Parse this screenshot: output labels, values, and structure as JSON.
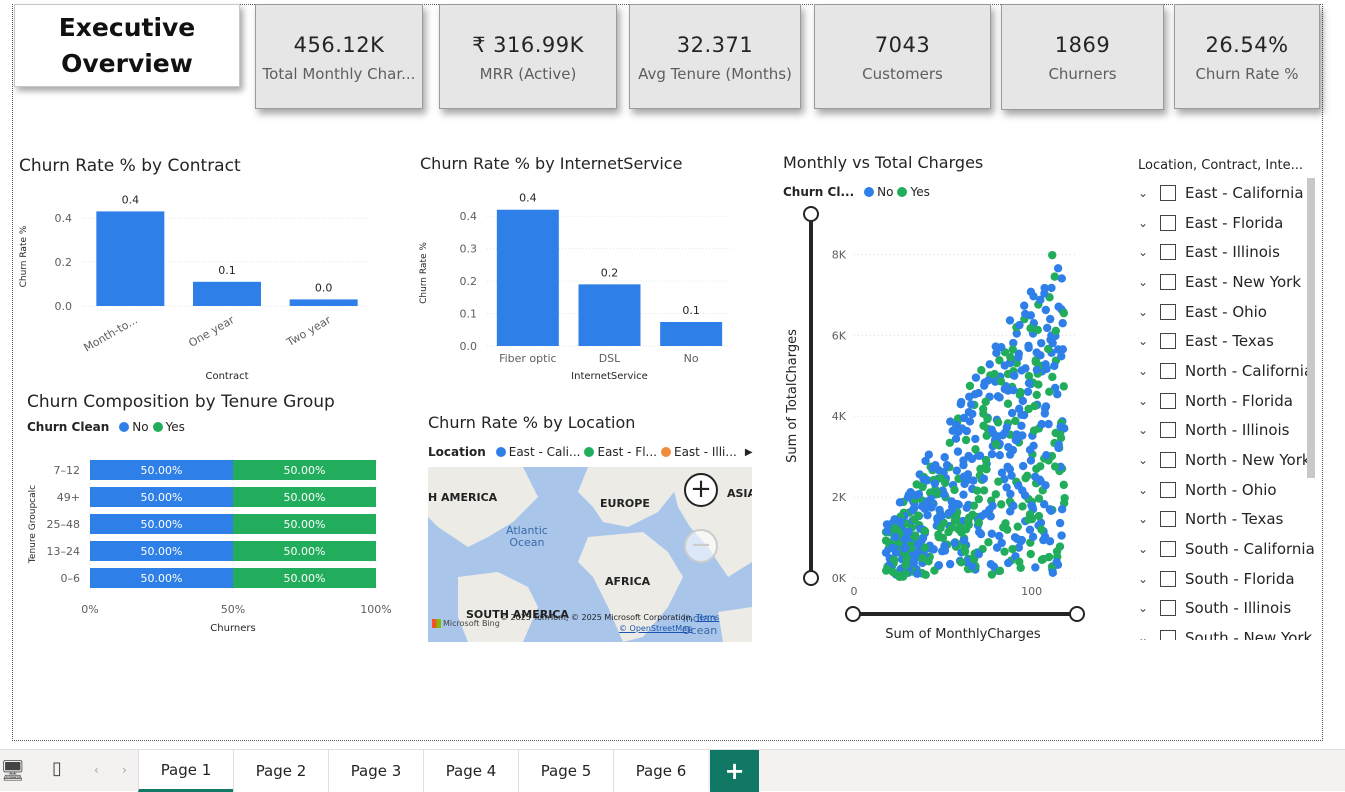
{
  "title": "Executive\nOverview",
  "kpis": [
    {
      "value": "456.12K",
      "label": "Total Monthly Char..."
    },
    {
      "value": "₹ 316.99K",
      "label": "MRR (Active)"
    },
    {
      "value": "32.371",
      "label": "Avg Tenure (Months)"
    },
    {
      "value": "7043",
      "label": "Customers"
    },
    {
      "value": "1869",
      "label": "Churners"
    },
    {
      "value": "26.54%",
      "label": "Churn Rate %"
    }
  ],
  "contract_chart": {
    "title": "Churn Rate % by Contract"
  },
  "internet_chart": {
    "title": "Churn Rate % by InternetService"
  },
  "tenure_chart": {
    "title": "Churn Composition by Tenure Group",
    "legend_title": "Churn Clean",
    "legend": [
      "No",
      "Yes"
    ]
  },
  "scatter_chart": {
    "title": "Monthly vs Total Charges",
    "legend_title": "Churn Cl...",
    "legend": [
      "No",
      "Yes"
    ]
  },
  "location_map": {
    "title": "Churn Rate % by Location",
    "legend_title": "Location",
    "legend": [
      "East - Cali...",
      "East - Fl...",
      "East - Illi..."
    ],
    "labels": [
      "H AMERICA",
      "EUROPE",
      "ASIA",
      "AFRICA",
      "SOUTH AMERICA"
    ],
    "ocean": "Atlantic\nOcean",
    "indian": "Indian\nOcean",
    "attribution": "© 2025 TomTom, © 2025 Microsoft Corporation,",
    "terms": "Terms",
    "osm": "© OpenStreetMap",
    "bing": "Microsoft Bing"
  },
  "slicer": {
    "title": "Location, Contract, Inte...",
    "items": [
      "East - California",
      "East - Florida",
      "East - Illinois",
      "East - New York",
      "East - Ohio",
      "East - Texas",
      "North - California",
      "North - Florida",
      "North - Illinois",
      "North - New York",
      "North - Ohio",
      "North - Texas",
      "South - California",
      "South - Florida",
      "South - Illinois",
      "South - New York"
    ]
  },
  "tabs": [
    "Page 1",
    "Page 2",
    "Page 3",
    "Page 4",
    "Page 5",
    "Page 6"
  ],
  "colors": {
    "no": "#2f7fe8",
    "yes": "#22ad5c",
    "third": "#f08c3c",
    "tab": "#117865"
  },
  "chart_data": [
    {
      "type": "bar",
      "title": "Churn Rate % by Contract",
      "xlabel": "Contract",
      "ylabel": "Churn Rate %",
      "categories": [
        "Month-to...",
        "One year",
        "Two year"
      ],
      "values": [
        0.43,
        0.11,
        0.03
      ],
      "data_labels": [
        "0.4",
        "0.1",
        "0.0"
      ],
      "yticks": [
        "0.0",
        "0.2",
        "0.4"
      ],
      "ylim": [
        0,
        0.45
      ]
    },
    {
      "type": "bar",
      "title": "Churn Rate % by InternetService",
      "xlabel": "InternetService",
      "ylabel": "Churn Rate %",
      "categories": [
        "Fiber optic",
        "DSL",
        "No"
      ],
      "values": [
        0.42,
        0.19,
        0.074
      ],
      "data_labels": [
        "0.4",
        "0.2",
        "0.1"
      ],
      "yticks": [
        "0.0",
        "0.1",
        "0.2",
        "0.3",
        "0.4"
      ],
      "ylim": [
        0,
        0.45
      ]
    },
    {
      "type": "bar",
      "title": "Churn Composition by Tenure Group",
      "xlabel": "Churners",
      "ylabel": "Tenure Groupcalc",
      "categories": [
        "7–12",
        "49+",
        "25–48",
        "13–24",
        "0–6"
      ],
      "series": [
        {
          "name": "No",
          "values": [
            50,
            50,
            50,
            50,
            50
          ],
          "labels": [
            "50.00%",
            "50.00%",
            "50.00%",
            "50.00%",
            "50.00%"
          ]
        },
        {
          "name": "Yes",
          "values": [
            50,
            50,
            50,
            50,
            50
          ],
          "labels": [
            "50.00%",
            "50.00%",
            "50.00%",
            "50.00%",
            "50.00%"
          ]
        }
      ],
      "xticks": [
        "0%",
        "50%",
        "100%"
      ],
      "stacked": "100%"
    },
    {
      "type": "scatter",
      "title": "Monthly vs Total Charges",
      "xlabel": "Sum of MonthlyCharges",
      "ylabel": "Sum of TotalCharges",
      "xticks": [
        "0",
        "100"
      ],
      "yticks": [
        "0K",
        "2K",
        "4K",
        "6K",
        "8K"
      ],
      "xlim": [
        0,
        125
      ],
      "ylim": [
        0,
        9000
      ],
      "series": [
        {
          "name": "No"
        },
        {
          "name": "Yes"
        }
      ]
    }
  ]
}
